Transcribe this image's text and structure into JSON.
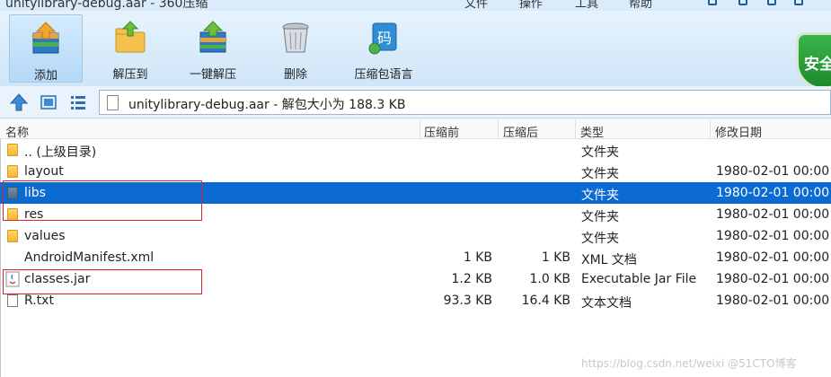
{
  "window": {
    "title": "unitylibrary-debug.aar - 360压缩",
    "menu": [
      "文件",
      "操作",
      "工具",
      "帮助"
    ]
  },
  "toolbar": {
    "buttons": [
      {
        "label": "添加",
        "icon": "add-archive-icon"
      },
      {
        "label": "解压到",
        "icon": "extract-to-icon"
      },
      {
        "label": "一键解压",
        "icon": "one-click-extract-icon"
      },
      {
        "label": "删除",
        "icon": "delete-trash-icon"
      },
      {
        "label": "压缩包语言",
        "icon": "archive-language-icon"
      }
    ],
    "badge": "安全",
    "language_icon_glyph": "码"
  },
  "address": {
    "text": "unitylibrary-debug.aar - 解包大小为 188.3 KB"
  },
  "columns": [
    "名称",
    "压缩前",
    "压缩后",
    "类型",
    "修改日期"
  ],
  "rows": [
    {
      "name": ".. (上级目录)",
      "before": "",
      "after": "",
      "type": "文件夹",
      "date": "",
      "kind": "folder"
    },
    {
      "name": "layout",
      "before": "",
      "after": "",
      "type": "文件夹",
      "date": "1980-02-01 00:00",
      "kind": "folder"
    },
    {
      "name": "libs",
      "before": "",
      "after": "",
      "type": "文件夹",
      "date": "1980-02-01 00:00",
      "kind": "folder",
      "selected": true
    },
    {
      "name": "res",
      "before": "",
      "after": "",
      "type": "文件夹",
      "date": "1980-02-01 00:00",
      "kind": "folder"
    },
    {
      "name": "values",
      "before": "",
      "after": "",
      "type": "文件夹",
      "date": "1980-02-01 00:00",
      "kind": "folder"
    },
    {
      "name": "AndroidManifest.xml",
      "before": "1 KB",
      "after": "1 KB",
      "type": "XML 文档",
      "date": "1980-02-01 00:00",
      "kind": "none"
    },
    {
      "name": "classes.jar",
      "before": "1.2 KB",
      "after": "1.0 KB",
      "type": "Executable Jar File",
      "date": "1980-02-01 00:00",
      "kind": "jar"
    },
    {
      "name": "R.txt",
      "before": "93.3 KB",
      "after": "16.4 KB",
      "type": "文本文档",
      "date": "1980-02-01 00:00",
      "kind": "doc"
    }
  ],
  "watermark": "https://blog.csdn.net/weixi @51CTO博客",
  "colors": {
    "selection": "#0b6bd3",
    "highlight_box": "#e0222a",
    "toolbar_bg": "#cfe5f8"
  }
}
